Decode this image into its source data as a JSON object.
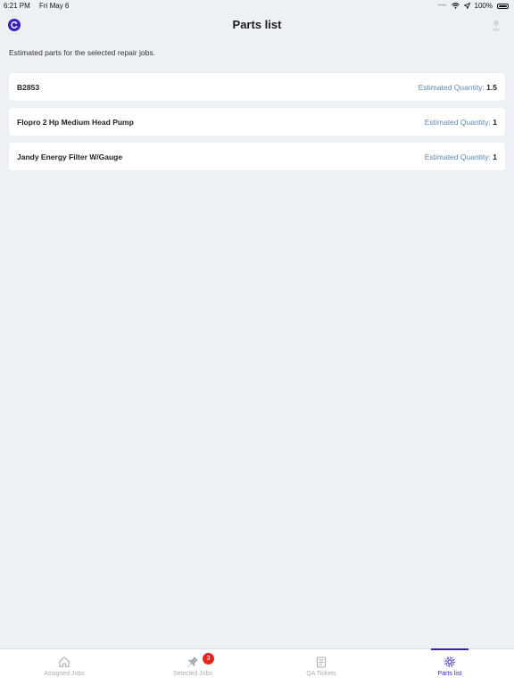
{
  "status_bar": {
    "time": "6:21 PM",
    "date": "Fri May 6",
    "battery": "100%"
  },
  "header": {
    "title": "Parts list",
    "logo_icon": "refresh-logo-icon",
    "avatar_icon": "user-avatar-icon"
  },
  "subtitle": "Estimated parts for the selected repair jobs.",
  "parts": [
    {
      "name": "B2853",
      "qty_label": "Estimated Quantity:",
      "qty": "1.5"
    },
    {
      "name": "Flopro 2 Hp Medium Head Pump",
      "qty_label": "Estimated Quantity:",
      "qty": "1"
    },
    {
      "name": "Jandy Energy Filter W/Gauge",
      "qty_label": "Estimated Quantity:",
      "qty": "1"
    }
  ],
  "tabs": [
    {
      "label": "Assigned Jobs",
      "icon": "home-icon"
    },
    {
      "label": "Selected Jobs",
      "icon": "pin-icon",
      "badge": "3"
    },
    {
      "label": "QA Tickets",
      "icon": "clipboard-icon"
    },
    {
      "label": "Parts list",
      "icon": "gear-icon",
      "active": true
    }
  ],
  "colors": {
    "accent": "#3a1fb8",
    "background": "#edf0f4",
    "qty_label": "#5b88b3",
    "badge": "#e0261d"
  }
}
